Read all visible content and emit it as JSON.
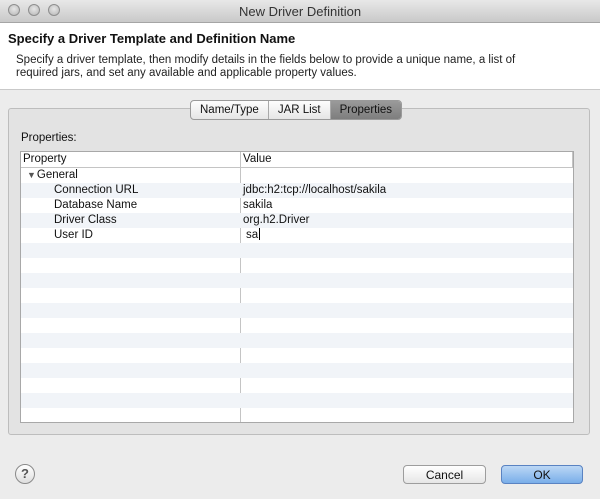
{
  "window": {
    "title": "New Driver Definition"
  },
  "header": {
    "title": "Specify a Driver Template and Definition Name",
    "description": "Specify a driver template, then modify details in the fields below to provide a unique name, a list of required jars, and set any available and applicable property values."
  },
  "tabs": [
    {
      "label": "Name/Type",
      "active": false
    },
    {
      "label": "JAR List",
      "active": false
    },
    {
      "label": "Properties",
      "active": true
    }
  ],
  "properties": {
    "label": "Properties:",
    "columns": {
      "property": "Property",
      "value": "Value"
    },
    "group": "General",
    "rows": [
      {
        "name": "Connection URL",
        "value": "jdbc:h2:tcp://localhost/sakila"
      },
      {
        "name": "Database Name",
        "value": "sakila"
      },
      {
        "name": "Driver Class",
        "value": "org.h2.Driver"
      },
      {
        "name": "User ID",
        "value": "sa"
      }
    ]
  },
  "footer": {
    "help_icon": "?",
    "cancel_label": "Cancel",
    "ok_label": "OK"
  }
}
